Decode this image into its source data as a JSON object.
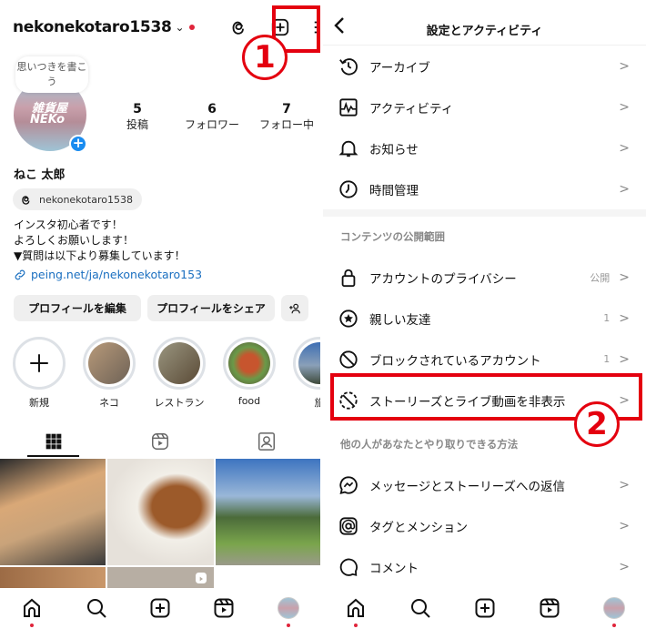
{
  "left": {
    "username": "nekonekotaro1538",
    "note_bubble": "思いつきを書こう",
    "avatar_text_1": "雑貨屋",
    "avatar_text_2": "NEKo",
    "stats": [
      {
        "value": "5",
        "label": "投稿"
      },
      {
        "value": "6",
        "label": "フォロワー"
      },
      {
        "value": "7",
        "label": "フォロー中"
      }
    ],
    "display_name": "ねこ 太郎",
    "threads_handle": "nekonekotaro1538",
    "bio": [
      "インスタ初心者です！",
      "よろしくお願いします！",
      "▼質問は以下より募集しています！"
    ],
    "link": "peing.net/ja/nekonekotaro153",
    "buttons": {
      "edit": "プロフィールを編集",
      "share": "プロフィールをシェア",
      "add_person": "+person"
    },
    "highlights": [
      {
        "label": "新規",
        "color": "#ffffff"
      },
      {
        "label": "ネコ",
        "color": "#8a7a66"
      },
      {
        "label": "レストラン",
        "color": "#6f6750"
      },
      {
        "label": "food",
        "color": "#b45a3a"
      },
      {
        "label": "旅",
        "color": "#5276a8"
      }
    ],
    "grid_colors": [
      "#c9a37a",
      "#e6e1da",
      "#4b7fb8",
      "#9c6b45",
      "#b7aea3"
    ]
  },
  "right": {
    "title": "設定とアクティビティ",
    "group1": [
      {
        "icon": "archive-icon",
        "label": "アーカイブ"
      },
      {
        "icon": "activity-icon",
        "label": "アクティビティ"
      },
      {
        "icon": "bell-icon",
        "label": "お知らせ"
      },
      {
        "icon": "clock-icon",
        "label": "時間管理"
      }
    ],
    "section2": "コンテンツの公開範囲",
    "group2": [
      {
        "icon": "lock-icon",
        "label": "アカウントのプライバシー",
        "value": "公開"
      },
      {
        "icon": "star-icon",
        "label": "親しい友達",
        "value": "1"
      },
      {
        "icon": "block-icon",
        "label": "ブロックされているアカウント",
        "value": "1"
      },
      {
        "icon": "hide-story-icon",
        "label": "ストーリーズとライブ動画を非表示",
        "value": ""
      }
    ],
    "section3": "他の人があなたとやり取りできる方法",
    "group3": [
      {
        "icon": "messenger-icon",
        "label": "メッセージとストーリーズへの返信"
      },
      {
        "icon": "at-icon",
        "label": "タグとメンション"
      },
      {
        "icon": "comment-icon",
        "label": "コメント"
      }
    ]
  },
  "annotations": {
    "step1": "1",
    "step2": "2"
  },
  "colors": {
    "accent_red": "#e4000f",
    "notif_dot": "#e0243b",
    "link_blue": "#1a6fc0"
  }
}
